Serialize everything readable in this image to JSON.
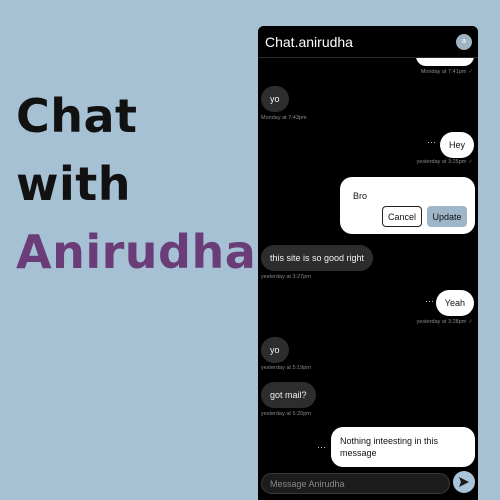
{
  "hero": {
    "line1": "Chat",
    "line2": "with",
    "line3": "Anirudha"
  },
  "app": {
    "brand_prefix": "Chat.",
    "brand_name": "anirudha",
    "avatar_letter": "a"
  },
  "messages": [
    {
      "dir": "out",
      "text": "",
      "time": "Monday at 7:41pm"
    },
    {
      "dir": "in",
      "text": "yo",
      "time": "Monday at 7:43pm"
    },
    {
      "dir": "out",
      "text": "Hey",
      "time": "yesterday at 3:25pm"
    },
    {
      "dir": "in",
      "text": "this site is so good right",
      "time": "yesterday at 3:27pm"
    },
    {
      "dir": "out",
      "text": "Yeah",
      "time": "yesterday at 3:28pm"
    },
    {
      "dir": "in",
      "text": "yo",
      "time": "yesterday at 5:19pm"
    },
    {
      "dir": "in",
      "text": "got mail?",
      "time": "yesterday at 5:20pm"
    },
    {
      "dir": "out",
      "text": "Nothing inteesting in this message",
      "time": ""
    }
  ],
  "edit": {
    "value": "Bro",
    "cancel_label": "Cancel",
    "update_label": "Update"
  },
  "menu_glyph": "···",
  "composer": {
    "placeholder": "Message Anirudha"
  },
  "colors": {
    "page_bg": "#a7c1d4",
    "accent": "#6a3d78",
    "panel_bg": "#000000",
    "incoming_bubble": "#2d2d2d",
    "outgoing_bubble": "#ffffff",
    "update_button": "#9fb6c8",
    "send_button": "#a9c4d8"
  },
  "icons": {
    "avatar": "avatar-icon",
    "send": "send-icon",
    "read": "check-icon"
  }
}
